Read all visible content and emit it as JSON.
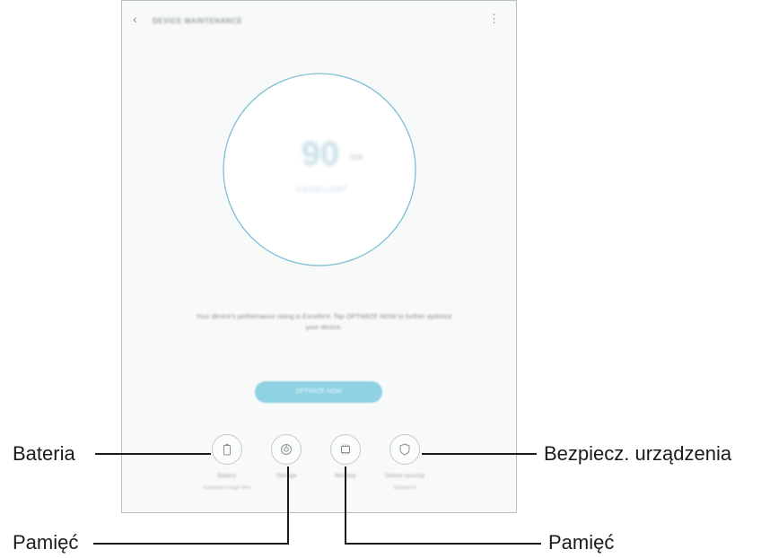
{
  "appbar": {
    "title": "DEVICE MAINTENANCE"
  },
  "score": {
    "value": "90",
    "unit": "/100",
    "status": "EXCELLENT"
  },
  "description": "Your device's performance rating is Excellent. Tap OPTIMIZE NOW to further optimize your device.",
  "optimize_button": "OPTIMIZE NOW",
  "categories": [
    {
      "name": "Battery",
      "sub": "Estimated usage time"
    },
    {
      "name": "Storage",
      "sub": ""
    },
    {
      "name": "Memory",
      "sub": ""
    },
    {
      "name": "Device security",
      "sub": "Optimized"
    }
  ],
  "callouts": {
    "bateria": "Bateria",
    "pamiec_left": "Pamięć",
    "pamiec_right": "Pamięć",
    "bezpiecz": "Bezpiecz. urządzenia"
  },
  "colors": {
    "ring": "#7cc0d4",
    "button": "#8fd2e3"
  }
}
